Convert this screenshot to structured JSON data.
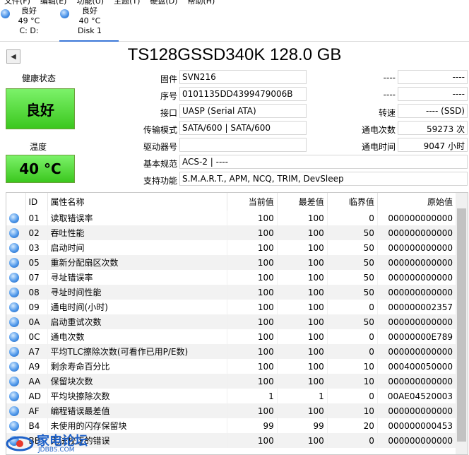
{
  "menu": [
    "文件(F)",
    "编辑(E)",
    "功能(U)",
    "主题(T)",
    "硬盘(D)",
    "帮助(H)"
  ],
  "disk_tabs": [
    {
      "status": "良好",
      "temp": "49 °C",
      "label": "C: D:"
    },
    {
      "status": "良好",
      "temp": "40 °C",
      "label": "Disk 1"
    }
  ],
  "title": "TS128GSSD340K 128.0 GB",
  "health": {
    "label": "健康状态",
    "value": "良好"
  },
  "temperature": {
    "label": "温度",
    "value": "40 °C"
  },
  "fields": {
    "firmware": {
      "label": "固件",
      "value": "SVN216"
    },
    "serial": {
      "label": "序号",
      "value": "0101135DD4399479006B"
    },
    "interface": {
      "label": "接口",
      "value": "UASP (Serial ATA)"
    },
    "transfer": {
      "label": "传输模式",
      "value": "SATA/600 | SATA/600"
    },
    "drive_letter": {
      "label": "驱动器号",
      "value": ""
    },
    "standard": {
      "label": "基本规范",
      "value": "ACS-2 | ----"
    },
    "features": {
      "label": "支持功能",
      "value": "S.M.A.R.T., APM, NCQ, TRIM, DevSleep"
    },
    "right1": {
      "label": "----",
      "value": "----"
    },
    "right2": {
      "label": "----",
      "value": "----"
    },
    "rotation": {
      "label": "转速",
      "value": "---- (SSD)"
    },
    "power_count": {
      "label": "通电次数",
      "value": "59273 次"
    },
    "power_hours": {
      "label": "通电时间",
      "value": "9047 小时"
    }
  },
  "table": {
    "headers": [
      "ID",
      "属性名称",
      "当前值",
      "最差值",
      "临界值",
      "原始值"
    ],
    "rows": [
      [
        "01",
        "读取错误率",
        "100",
        "100",
        "0",
        "000000000000"
      ],
      [
        "02",
        "吞吐性能",
        "100",
        "100",
        "50",
        "000000000000"
      ],
      [
        "03",
        "启动时间",
        "100",
        "100",
        "50",
        "000000000000"
      ],
      [
        "05",
        "重新分配扇区次数",
        "100",
        "100",
        "50",
        "000000000000"
      ],
      [
        "07",
        "寻址错误率",
        "100",
        "100",
        "50",
        "000000000000"
      ],
      [
        "08",
        "寻址时间性能",
        "100",
        "100",
        "50",
        "000000000000"
      ],
      [
        "09",
        "通电时间(小时)",
        "100",
        "100",
        "0",
        "000000002357"
      ],
      [
        "0A",
        "启动重试次数",
        "100",
        "100",
        "50",
        "000000000000"
      ],
      [
        "0C",
        "通电次数",
        "100",
        "100",
        "0",
        "00000000E789"
      ],
      [
        "A7",
        "平均TLC擦除次数(可看作已用P/E数)",
        "100",
        "100",
        "0",
        "000000000000"
      ],
      [
        "A9",
        "剩余寿命百分比",
        "100",
        "100",
        "10",
        "000400050000"
      ],
      [
        "AA",
        "保留块次数",
        "100",
        "100",
        "10",
        "000000000000"
      ],
      [
        "AD",
        "平均块擦除次数",
        "1",
        "1",
        "0",
        "00AE04520003"
      ],
      [
        "AF",
        "编程错误最差值",
        "100",
        "100",
        "10",
        "000000000000"
      ],
      [
        "B4",
        "未使用的闪存保留块",
        "99",
        "99",
        "20",
        "000000000453"
      ],
      [
        "BB",
        "无法校正的错误",
        "100",
        "100",
        "0",
        "000000000000"
      ]
    ]
  },
  "watermark": {
    "text": "家电论坛",
    "sub": "JDBBS.COM"
  },
  "colors": {
    "health_green": "#3bc71e",
    "tab_blue": "#3c78d8"
  }
}
